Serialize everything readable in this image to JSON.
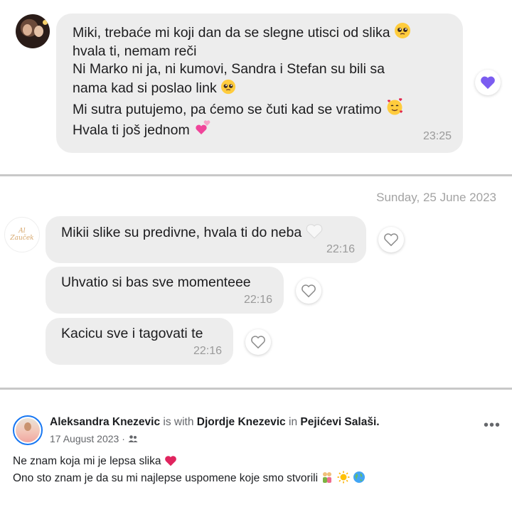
{
  "panel1": {
    "message_lines": [
      "Miki, trebaće mi koji dan da se slegne utisci od slika",
      "hvala ti, nemam reči",
      "Ni Marko ni ja, ni kumovi, Sandra i Stefan su bili sa",
      "nama kad si poslao link",
      "Mi sutra putujemo, pa ćemo se čuti kad se vratimo",
      "Hvala ti još jednom"
    ],
    "time": "23:25",
    "reaction": "purple-heart-icon",
    "colors": {
      "bubble": "#ededed",
      "reaction": "#7b5cf0"
    }
  },
  "panel2": {
    "date_separator": "Sunday, 25 June 2023",
    "avatar_text": [
      "Al",
      "Zauček"
    ],
    "messages": [
      {
        "text": "Mikii slike su predivne, hvala ti do neba",
        "time": "22:16"
      },
      {
        "text": "Uhvatio si bas sve momenteee",
        "time": "22:16"
      },
      {
        "text": "Kacicu sve i tagovati te",
        "time": "22:16"
      }
    ]
  },
  "panel3": {
    "author": "Aleksandra Knezevic",
    "is_with_label": "is with",
    "tagged": "Djordje Knezevic",
    "in_label": "in",
    "place": "Pejićevi Salaši.",
    "date": "17 August 2023 ·",
    "audience_icon": "friends-icon",
    "more_label": "•••",
    "text_lines": [
      "Ne znam koja mi je lepsa slika",
      "Ono sto znam je da su mi najlepse uspomene koje smo stvorili"
    ],
    "colors": {
      "link_blue": "#1877f2",
      "heart_red": "#e0245e"
    }
  }
}
